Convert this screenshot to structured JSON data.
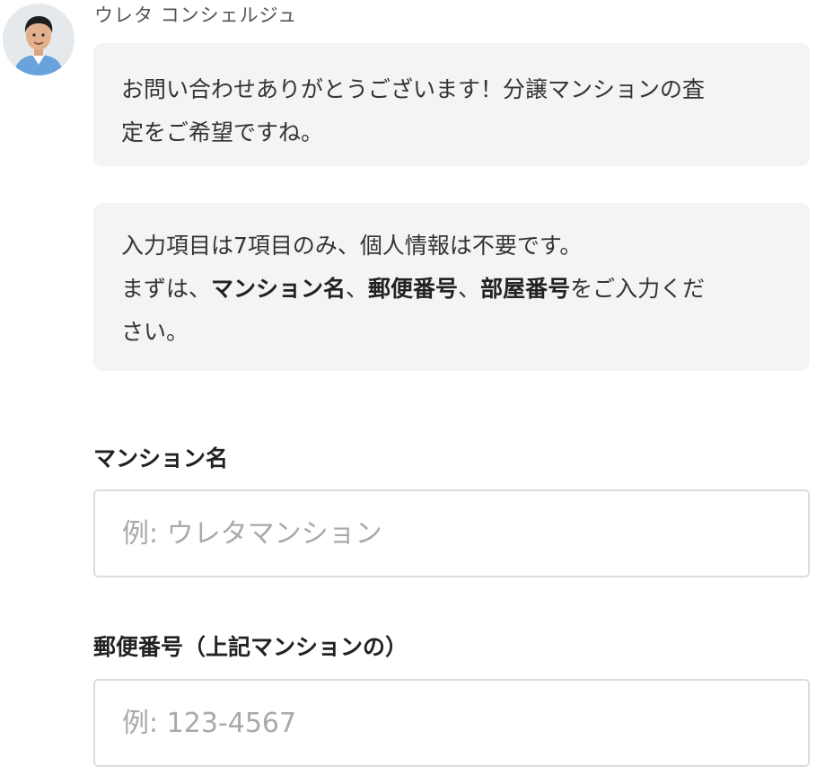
{
  "sender": {
    "name": "ウレタ コンシェルジュ",
    "avatar_icon": "person-avatar-icon"
  },
  "messages": [
    {
      "lines": [
        [
          {
            "text": "お問い合わせありがとうございます！分譲マンションの査",
            "bold": false
          }
        ],
        [
          {
            "text": "定をご希望ですね。",
            "bold": false
          }
        ]
      ]
    },
    {
      "lines": [
        [
          {
            "text": "入力項目は7項目のみ、個人情報は不要です。",
            "bold": false
          }
        ],
        [
          {
            "text": "まずは、",
            "bold": false
          },
          {
            "text": "マンション名",
            "bold": true
          },
          {
            "text": "、",
            "bold": false
          },
          {
            "text": "郵便番号",
            "bold": true
          },
          {
            "text": "、",
            "bold": false
          },
          {
            "text": "部屋番号",
            "bold": true
          },
          {
            "text": "をご入力くだ",
            "bold": false
          }
        ],
        [
          {
            "text": "さい。",
            "bold": false
          }
        ]
      ]
    }
  ],
  "form": {
    "mansion_name": {
      "label": "マンション名",
      "placeholder": "例: ウレタマンション",
      "value": ""
    },
    "postal_code": {
      "label": "郵便番号（上記マンションの）",
      "placeholder": "例: 123-4567",
      "value": ""
    }
  },
  "colors": {
    "bubble_background": "#f4f4f4",
    "text": "#333333",
    "placeholder": "#a9a9a9",
    "input_border": "#dcdcdc"
  }
}
